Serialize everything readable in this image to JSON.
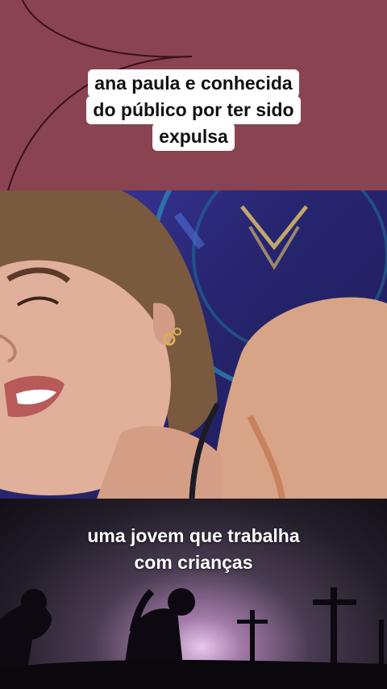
{
  "top_caption": {
    "lines": [
      "ana paula e conhecida",
      "do público por ter sido",
      "expulsa"
    ]
  },
  "bottom_caption": {
    "lines": [
      "uma jovem que trabalha",
      "com crianças"
    ]
  },
  "colors": {
    "top_background": "#8a4350",
    "caption_box": "#ffffff",
    "photo_background": "#2d2a82"
  }
}
